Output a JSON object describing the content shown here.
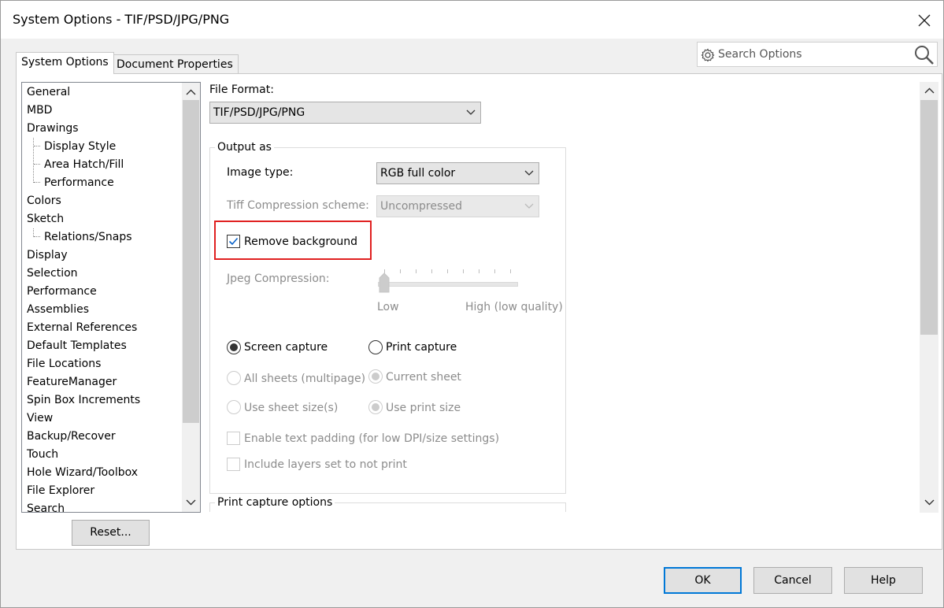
{
  "window": {
    "title": "System Options - TIF/PSD/JPG/PNG"
  },
  "search": {
    "placeholder": "Search Options"
  },
  "tabs": [
    {
      "label": "System Options",
      "active": true
    },
    {
      "label": "Document Properties",
      "active": false
    }
  ],
  "sidebar": {
    "items": [
      {
        "label": "General",
        "level": 0
      },
      {
        "label": "MBD",
        "level": 0
      },
      {
        "label": "Drawings",
        "level": 0
      },
      {
        "label": "Display Style",
        "level": 1
      },
      {
        "label": "Area Hatch/Fill",
        "level": 1
      },
      {
        "label": "Performance",
        "level": 1
      },
      {
        "label": "Colors",
        "level": 0
      },
      {
        "label": "Sketch",
        "level": 0
      },
      {
        "label": "Relations/Snaps",
        "level": 1
      },
      {
        "label": "Display",
        "level": 0
      },
      {
        "label": "Selection",
        "level": 0
      },
      {
        "label": "Performance",
        "level": 0
      },
      {
        "label": "Assemblies",
        "level": 0
      },
      {
        "label": "External References",
        "level": 0
      },
      {
        "label": "Default Templates",
        "level": 0
      },
      {
        "label": "File Locations",
        "level": 0
      },
      {
        "label": "FeatureManager",
        "level": 0
      },
      {
        "label": "Spin Box Increments",
        "level": 0
      },
      {
        "label": "View",
        "level": 0
      },
      {
        "label": "Backup/Recover",
        "level": 0
      },
      {
        "label": "Touch",
        "level": 0
      },
      {
        "label": "Hole Wizard/Toolbox",
        "level": 0
      },
      {
        "label": "File Explorer",
        "level": 0
      },
      {
        "label": "Search",
        "level": 0
      }
    ],
    "reset_label": "Reset..."
  },
  "main": {
    "file_format_label": "File Format:",
    "file_format_value": "TIF/PSD/JPG/PNG",
    "output_group_title": "Output as",
    "image_type_label": "Image type:",
    "image_type_value": "RGB full color",
    "tiff_label": "Tiff Compression scheme:",
    "tiff_value": "Uncompressed",
    "remove_background_label": "Remove background",
    "remove_background_checked": true,
    "jpeg_label": "Jpeg Compression:",
    "jpeg_low": "Low",
    "jpeg_high": "High (low quality)",
    "screen_capture_label": "Screen capture",
    "print_capture_label": "Print capture",
    "capture_mode": "Screen capture",
    "all_sheets_label": "All sheets (multipage)",
    "current_sheet_label": "Current sheet",
    "use_sheet_size_label": "Use sheet size(s)",
    "use_print_size_label": "Use print size",
    "enable_text_padding_label": "Enable text padding (for low DPI/size settings)",
    "include_layers_label": "Include layers set to not print",
    "print_capture_group_title": "Print capture options"
  },
  "footer": {
    "ok_label": "OK",
    "cancel_label": "Cancel",
    "help_label": "Help"
  },
  "colors": {
    "highlight_border": "#e02020",
    "default_button_border": "#0078d7"
  }
}
